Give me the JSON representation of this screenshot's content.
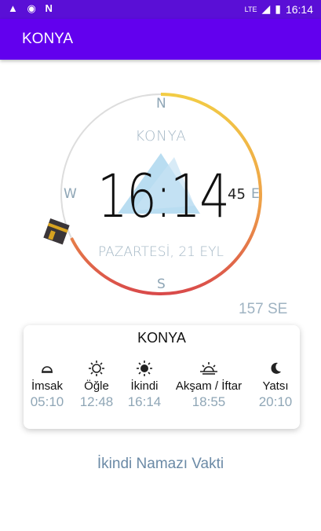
{
  "status_bar": {
    "left_icons": [
      "warning-icon",
      "sync-icon",
      "n-icon"
    ],
    "network": "LTE",
    "time": "16:14"
  },
  "app_bar": {
    "title": "KONYA"
  },
  "compass": {
    "city": "KONYA",
    "time": "16:14",
    "seconds": "45",
    "date": "PAZARTESİ, 21 EYL",
    "north": "N",
    "east": "E",
    "south": "S",
    "west": "W",
    "heading": "157 SE",
    "colors": {
      "ring": "#dddddd",
      "gradient_start": "#f2cc45",
      "gradient_end": "#d94a4a",
      "pointer": "#a8d4ee"
    }
  },
  "prayer_card": {
    "city": "KONYA",
    "times": [
      {
        "name": "İmsak",
        "time": "05:10",
        "icon": "dome-icon"
      },
      {
        "name": "Öğle",
        "time": "12:48",
        "icon": "sun-icon"
      },
      {
        "name": "İkindi",
        "time": "16:14",
        "icon": "sun-bright-icon"
      },
      {
        "name": "Akşam / İftar",
        "time": "18:55",
        "icon": "sunset-icon"
      },
      {
        "name": "Yatsı",
        "time": "20:10",
        "icon": "moon-icon"
      }
    ]
  },
  "current_prayer_label": "İkindi Namazı Vakti"
}
